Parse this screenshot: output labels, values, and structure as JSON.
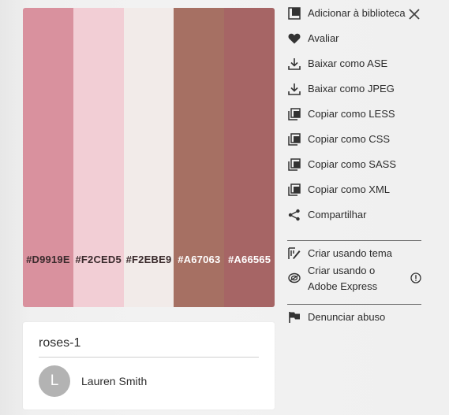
{
  "palette": {
    "swatches": [
      {
        "hex": "#D9919E",
        "label": "#D9919E",
        "text_color": "#3a2a2c"
      },
      {
        "hex": "#F2CED5",
        "label": "#F2CED5",
        "text_color": "#3a2a2c"
      },
      {
        "hex": "#F2EBE9",
        "label": "#F2EBE9",
        "text_color": "#3a2a2c"
      },
      {
        "hex": "#A67063",
        "label": "#A67063",
        "text_color": "#ffffff"
      },
      {
        "hex": "#A66565",
        "label": "#A66565",
        "text_color": "#ffffff"
      }
    ]
  },
  "card": {
    "title": "roses-1",
    "avatar_initial": "L",
    "author": "Lauren Smith"
  },
  "menu": {
    "items": [
      {
        "label": "Adicionar à biblioteca",
        "icon": "library-add-icon"
      },
      {
        "label": "Avaliar",
        "icon": "heart-icon"
      },
      {
        "label": "Baixar como ASE",
        "icon": "download-icon"
      },
      {
        "label": "Baixar como JPEG",
        "icon": "download-icon"
      },
      {
        "label": "Copiar como LESS",
        "icon": "copy-icon"
      },
      {
        "label": "Copiar como CSS",
        "icon": "copy-icon"
      },
      {
        "label": "Copiar como SASS",
        "icon": "copy-icon"
      },
      {
        "label": "Copiar como XML",
        "icon": "copy-icon"
      },
      {
        "label": "Compartilhar",
        "icon": "share-icon"
      }
    ],
    "create_with_theme": "Criar usando tema",
    "create_with_express_line1": "Criar usando o",
    "create_with_express_line2": "Adobe Express",
    "report_abuse": "Denunciar abuso"
  },
  "icons": {
    "close": "close-icon",
    "info": "info-icon"
  }
}
